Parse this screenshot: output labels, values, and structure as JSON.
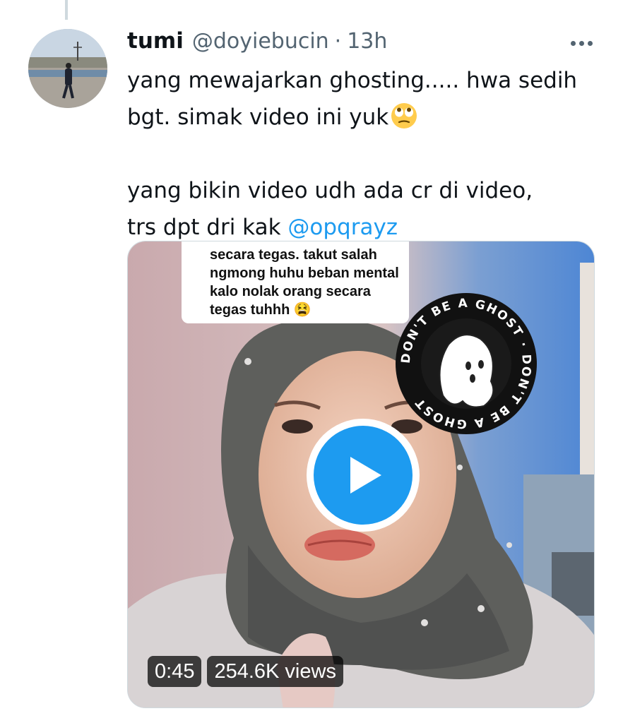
{
  "tweet": {
    "author_name": "tumi",
    "author_handle": "@doyiebucin",
    "separator": "·",
    "time": "13h",
    "text_line1": "yang mewajarkan ghosting..... hwa sedih",
    "text_line2": "bgt. simak video ini yuk",
    "text_line3": "yang bikin video udh ada cr di video,",
    "text_line4": "trs dpt dri kak ",
    "mention": "@opqrayz"
  },
  "video": {
    "caption_lines": [
      "secara tegas. takut salah",
      "ngmong huhu beban mental",
      "kalo nolak orang secara",
      "tegas tuhhh"
    ],
    "sticker_text": "DON'T BE A GHOST · DON'T BE A GHOST",
    "duration": "0:45",
    "views": "254.6K views"
  },
  "colors": {
    "accent": "#1d9bf0",
    "text": "#0f1419",
    "secondary": "#536471"
  },
  "icons": {
    "more": "more-horizontal-icon",
    "play": "play-icon",
    "emoji": "face-with-rolling-eyes-emoji"
  }
}
